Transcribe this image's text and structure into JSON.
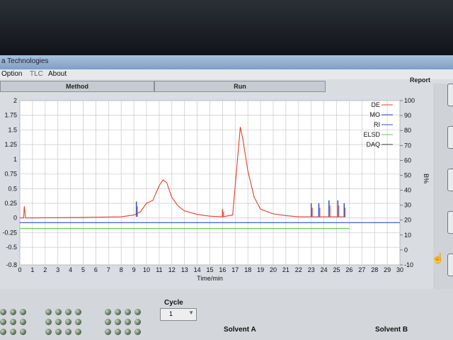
{
  "window": {
    "title": "a Technologies"
  },
  "menu": {
    "items": [
      "Option",
      "TLC",
      "About"
    ]
  },
  "tabs": [
    "Method",
    "Run",
    "Report"
  ],
  "chart_data": {
    "type": "line",
    "xlabel": "Time/min",
    "xlim": [
      0,
      30
    ],
    "ylim_left": [
      -0.8,
      2
    ],
    "ylim_right": [
      -10,
      100
    ],
    "right_axis_label": "B%",
    "x_ticks": [
      0,
      1,
      2,
      3,
      4,
      5,
      6,
      7,
      8,
      9,
      10,
      11,
      12,
      13,
      14,
      15,
      16,
      17,
      18,
      19,
      20,
      21,
      22,
      23,
      24,
      25,
      26,
      27,
      28,
      29,
      30
    ],
    "y_ticks_left": [
      "2",
      "1.75",
      "1.5",
      "1.25",
      "1",
      "0.75",
      "0.5",
      "0.25",
      "0",
      "-0.25",
      "-0.5",
      "-0.8"
    ],
    "y_ticks_right": [
      "100",
      "90",
      "80",
      "70",
      "60",
      "50",
      "40",
      "30",
      "20",
      "10",
      "0",
      "-10"
    ],
    "legend": [
      "DE",
      "MO",
      "RI",
      "ELSD",
      "DAQ"
    ],
    "grid": true,
    "series": [
      {
        "name": "DE",
        "color": "#e0402a",
        "x": [
          0,
          0.3,
          0.35,
          0.45,
          5,
          8,
          9,
          9.5,
          10,
          10.5,
          11,
          11.3,
          11.6,
          12,
          12.5,
          13,
          14,
          15,
          16,
          16.8,
          17.1,
          17.4,
          17.6,
          18,
          18.5,
          19,
          20,
          21,
          22,
          23,
          24,
          25,
          25.5,
          25.7
        ],
        "y": [
          0,
          0,
          0.2,
          0,
          0.01,
          0.02,
          0.05,
          0.1,
          0.25,
          0.3,
          0.55,
          0.65,
          0.6,
          0.35,
          0.2,
          0.12,
          0.06,
          0.03,
          0.02,
          0.05,
          0.8,
          1.55,
          1.35,
          0.8,
          0.35,
          0.15,
          0.07,
          0.04,
          0.02,
          0.02,
          0.02,
          0.02,
          0.02,
          0.02
        ]
      },
      {
        "name": "RI",
        "color": "#2a4fd0",
        "x": [
          0,
          30
        ],
        "y": [
          -0.08,
          -0.08
        ]
      },
      {
        "name": "ELSD",
        "color": "#55d04a",
        "x": [
          0,
          26
        ],
        "y": [
          -0.18,
          -0.18
        ]
      }
    ],
    "spikes": [
      {
        "x": 9.2,
        "y": 0.28,
        "color": "#3050c8"
      },
      {
        "x": 16,
        "y": 0.15,
        "color": "#e0402a"
      },
      {
        "x": 23,
        "y": 0.25,
        "color": "#3050c8"
      },
      {
        "x": 23.6,
        "y": 0.25,
        "color": "#3050c8"
      },
      {
        "x": 24.4,
        "y": 0.3,
        "color": "#3050c8"
      },
      {
        "x": 25.1,
        "y": 0.3,
        "color": "#3050c8"
      },
      {
        "x": 25.6,
        "y": 0.25,
        "color": "#3050c8"
      }
    ]
  },
  "bottom": {
    "cycle_label": "Cycle",
    "cycle_value": "1",
    "solvent_a": "Solvent A",
    "solvent_b": "Solvent B"
  }
}
